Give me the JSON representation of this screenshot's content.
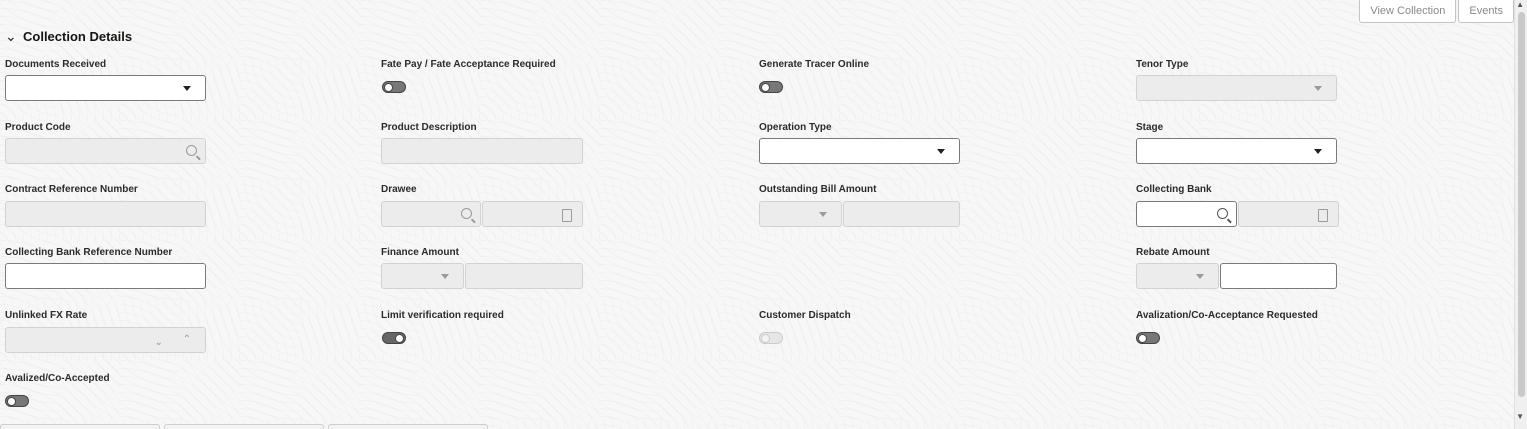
{
  "header": {
    "view_collection_label": "View Collection",
    "events_label": "Events"
  },
  "section": {
    "title": "Collection Details"
  },
  "fields": {
    "documents_received": {
      "label": "Documents Received",
      "value": ""
    },
    "fate_pay": {
      "label": "Fate Pay / Fate Acceptance Required",
      "state": "off"
    },
    "generate_tracer_online": {
      "label": "Generate Tracer Online",
      "state": "off"
    },
    "tenor_type": {
      "label": "Tenor Type",
      "value": ""
    },
    "product_code": {
      "label": "Product Code",
      "value": ""
    },
    "product_description": {
      "label": "Product Description",
      "value": ""
    },
    "operation_type": {
      "label": "Operation Type",
      "value": ""
    },
    "stage": {
      "label": "Stage",
      "value": ""
    },
    "contract_reference_number": {
      "label": "Contract Reference Number",
      "value": ""
    },
    "drawee": {
      "label": "Drawee",
      "value": ""
    },
    "outstanding_bill_amount": {
      "label": "Outstanding Bill Amount",
      "value": ""
    },
    "collecting_bank": {
      "label": "Collecting Bank",
      "value": ""
    },
    "collecting_bank_reference_number": {
      "label": "Collecting Bank Reference Number",
      "value": ""
    },
    "finance_amount": {
      "label": "Finance Amount",
      "value": ""
    },
    "rebate_amount": {
      "label": "Rebate Amount",
      "value": ""
    },
    "unlinked_fx_rate": {
      "label": "Unlinked FX Rate",
      "value": ""
    },
    "limit_verification_required": {
      "label": "Limit verification required",
      "state": "on"
    },
    "customer_dispatch": {
      "label": "Customer Dispatch",
      "state": "disabled"
    },
    "avalization_requested": {
      "label": "Avalization/Co-Acceptance Requested",
      "state": "off"
    },
    "avalized_co_accepted": {
      "label": "Avalized/Co-Accepted",
      "state": "off"
    }
  },
  "icons": [
    "chevron-down-icon",
    "dropdown-caret-icon",
    "search-icon",
    "document-icon",
    "stepper-down-icon",
    "stepper-up-icon"
  ]
}
